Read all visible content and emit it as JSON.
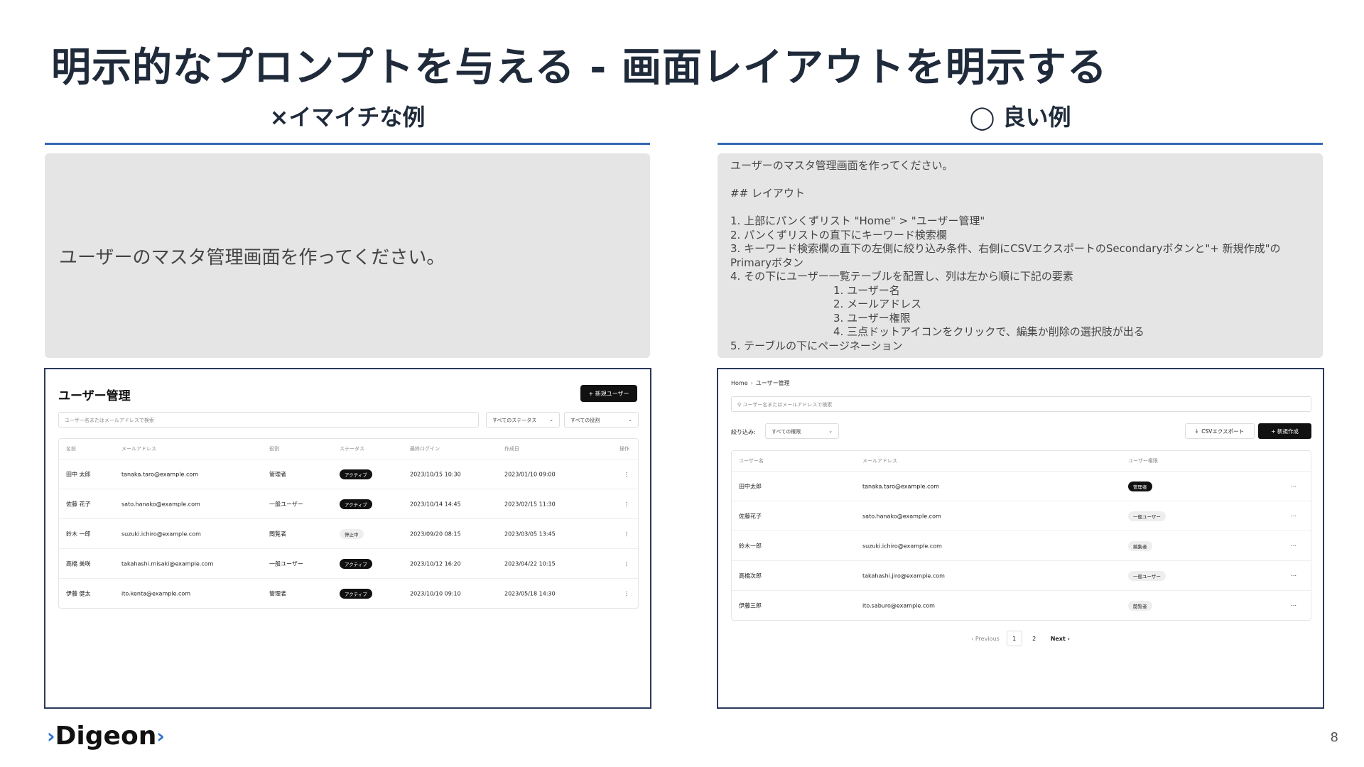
{
  "slide": {
    "title": "明示的なプロンプトを与える - 画面レイアウトを明示する",
    "page_number": "8",
    "logo_text": "Digeon",
    "accent_color": "#3566b5"
  },
  "bad": {
    "heading": "×イマイチな例",
    "prompt": "ユーザーのマスタ管理画面を作ってください。",
    "mock": {
      "title": "ユーザー管理",
      "new_button": "+ 新規ユーザー",
      "search_placeholder": "ユーザー名またはメールアドレスで検索",
      "status_select": "すべてのステータス",
      "role_select": "すべての役割",
      "columns": [
        "名前",
        "メールアドレス",
        "役割",
        "ステータス",
        "最終ログイン",
        "作成日",
        "操作"
      ],
      "rows": [
        {
          "name": "田中 太郎",
          "email": "tanaka.taro@example.com",
          "role": "管理者",
          "status": "アクティブ",
          "status_dark": true,
          "last_login": "2023/10/15 10:30",
          "created": "2023/01/10 09:00",
          "action": "⋮"
        },
        {
          "name": "佐藤 花子",
          "email": "sato.hanako@example.com",
          "role": "一般ユーザー",
          "status": "アクティブ",
          "status_dark": true,
          "last_login": "2023/10/14 14:45",
          "created": "2023/02/15 11:30",
          "action": "⋮"
        },
        {
          "name": "鈴木 一郎",
          "email": "suzuki.ichiro@example.com",
          "role": "閲覧者",
          "status": "停止中",
          "status_dark": false,
          "last_login": "2023/09/20 08:15",
          "created": "2023/03/05 13:45",
          "action": "⋮"
        },
        {
          "name": "高橋 美咲",
          "email": "takahashi.misaki@example.com",
          "role": "一般ユーザー",
          "status": "アクティブ",
          "status_dark": true,
          "last_login": "2023/10/12 16:20",
          "created": "2023/04/22 10:15",
          "action": "⋮"
        },
        {
          "name": "伊藤 健太",
          "email": "ito.kenta@example.com",
          "role": "管理者",
          "status": "アクティブ",
          "status_dark": true,
          "last_login": "2023/10/10 09:10",
          "created": "2023/05/18 14:30",
          "action": "⋮"
        }
      ]
    }
  },
  "good": {
    "heading": "◯ 良い例",
    "prompt_lines": [
      "ユーザーのマスタ管理画面を作ってください。",
      "",
      "## レイアウト",
      "",
      "1. 上部にパンくずリスト \"Home\" > \"ユーザー管理\"",
      "2. パンくずリストの直下にキーワード検索欄",
      "3. キーワード検索欄の直下の左側に絞り込み条件、右側にCSVエクスポートのSecondaryボタンと\"+ 新規作成\"のPrimaryボタン",
      "4. その下にユーザー一覧テーブルを配置し、列は左から順に下記の要素",
      "1. ユーザー名",
      "2. メールアドレス",
      "3. ユーザー権限",
      "4. 三点ドットアイコンをクリックで、編集か削除の選択肢が出る",
      "5. テーブルの下にページネーション"
    ],
    "mock": {
      "crumb_home": "Home",
      "crumb_sep": "›",
      "crumb_current": "ユーザー管理",
      "search_placeholder": "ユーザー名またはメールアドレスで検索",
      "filter_label": "絞り込み:",
      "filter_select": "すべての権限",
      "csv_button": "CSVエクスポート",
      "new_button": "+ 新規作成",
      "columns": [
        "ユーザー名",
        "メールアドレス",
        "ユーザー権限",
        ""
      ],
      "rows": [
        {
          "name": "田中太郎",
          "email": "tanaka.taro@example.com",
          "role": "管理者",
          "role_dark": true,
          "action": "···"
        },
        {
          "name": "佐藤花子",
          "email": "sato.hanako@example.com",
          "role": "一般ユーザー",
          "role_dark": false,
          "action": "···"
        },
        {
          "name": "鈴木一郎",
          "email": "suzuki.ichiro@example.com",
          "role": "編集者",
          "role_dark": false,
          "action": "···"
        },
        {
          "name": "高橋次郎",
          "email": "takahashi.jiro@example.com",
          "role": "一般ユーザー",
          "role_dark": false,
          "action": "···"
        },
        {
          "name": "伊藤三郎",
          "email": "ito.saburo@example.com",
          "role": "閲覧者",
          "role_dark": false,
          "action": "···"
        }
      ],
      "pagination": {
        "prev": "‹ Previous",
        "pages": [
          "1",
          "2"
        ],
        "current": "1",
        "next": "Next ›"
      }
    }
  }
}
